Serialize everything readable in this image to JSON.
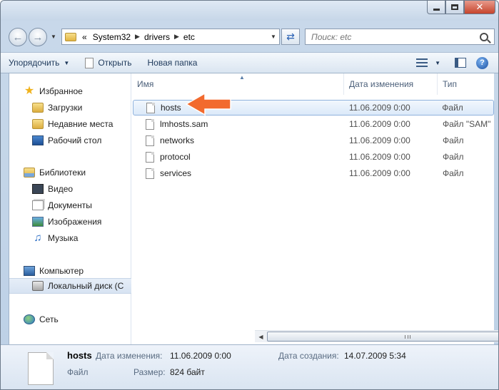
{
  "window": {
    "close_glyph": "✕"
  },
  "address": {
    "overflow": "«",
    "crumbs": [
      "System32",
      "drivers",
      "etc"
    ],
    "search_placeholder": "Поиск: etc"
  },
  "toolbar": {
    "organize": "Упорядочить",
    "open": "Открыть",
    "new_folder": "Новая папка",
    "help": "?"
  },
  "nav": {
    "favorites": "Избранное",
    "downloads": "Загрузки",
    "recent": "Недавние места",
    "desktop": "Рабочий стол",
    "libraries": "Библиотеки",
    "video": "Видео",
    "documents": "Документы",
    "images": "Изображения",
    "music": "Музыка",
    "computer": "Компьютер",
    "local_disk": "Локальный диск (C",
    "network": "Сеть"
  },
  "columns": {
    "name": "Имя",
    "date": "Дата изменения",
    "type": "Тип"
  },
  "files": [
    {
      "name": "hosts",
      "date": "11.06.2009 0:00",
      "type": "Файл"
    },
    {
      "name": "lmhosts.sam",
      "date": "11.06.2009 0:00",
      "type": "Файл \"SAM\""
    },
    {
      "name": "networks",
      "date": "11.06.2009 0:00",
      "type": "Файл"
    },
    {
      "name": "protocol",
      "date": "11.06.2009 0:00",
      "type": "Файл"
    },
    {
      "name": "services",
      "date": "11.06.2009 0:00",
      "type": "Файл"
    }
  ],
  "details": {
    "name": "hosts",
    "kind": "Файл",
    "modified_label": "Дата изменения:",
    "modified_value": "11.06.2009 0:00",
    "created_label": "Дата создания:",
    "created_value": "14.07.2009 5:34",
    "size_label": "Размер:",
    "size_value": "824 байт"
  },
  "colors": {
    "annotation_arrow": "#f26a2e",
    "selection": "#dbe9f9"
  }
}
